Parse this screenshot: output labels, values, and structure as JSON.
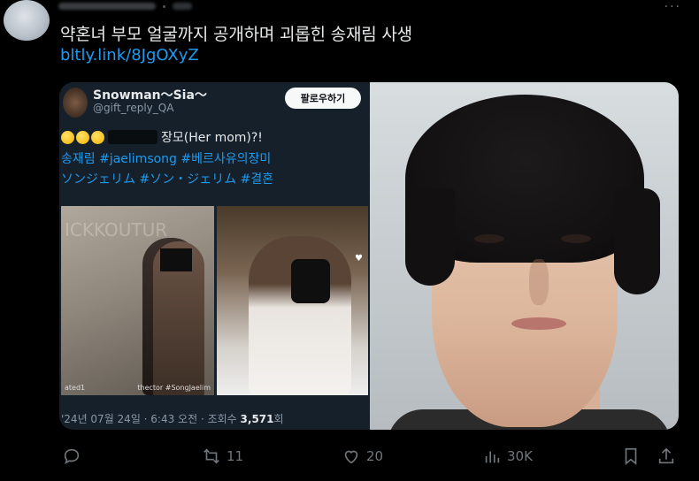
{
  "header": {
    "more": "···"
  },
  "tweet": {
    "text": "약혼녀 부모 얼굴까지 공개하며 괴롭힌 송재림 사생",
    "link": "bltly.link/8JgOXyZ"
  },
  "quoted": {
    "name": "Snowman〜Sia〜",
    "handle": "@gift_reply_QA",
    "follow_label": "팔로우하기",
    "line1_tail": "장모(Her mom)?!",
    "line2": "송재림 #jaelimsong #베르사유의장미",
    "line3": "ソンジェリム #ソン・ジェリム #결혼",
    "photo_a_caption_left": "ated1",
    "photo_a_caption_right": "thector #SongJaelim",
    "photo_a_letters": "ICKKOUTUR",
    "meta_prefix": "'24년 07월 24일 · 6:43 오전 · 조회수 ",
    "meta_views": "3,571",
    "meta_suffix": "회"
  },
  "actions": {
    "reply_count": "",
    "retweet_count": "11",
    "like_count": "20",
    "views_count": "30K"
  },
  "icons": [
    "reply-icon",
    "retweet-icon",
    "heart-icon",
    "views-icon",
    "bookmark-icon",
    "share-icon"
  ],
  "colors": {
    "link": "#1d9bf0",
    "muted": "#71767b",
    "bg": "#000000"
  }
}
